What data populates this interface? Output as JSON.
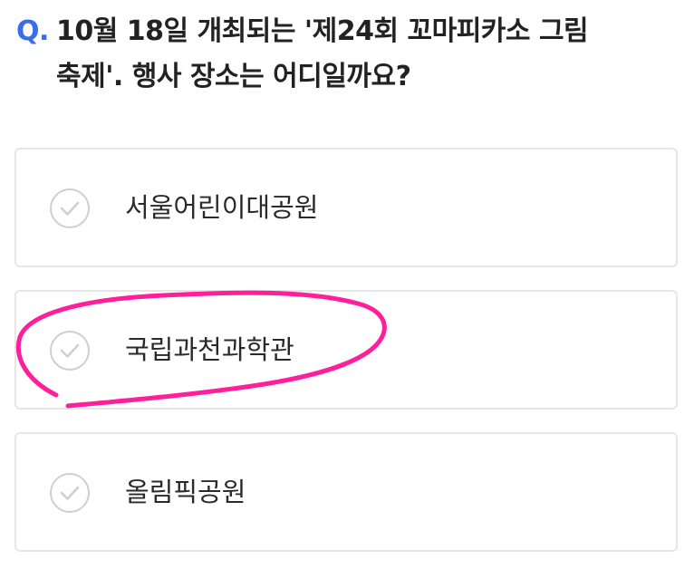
{
  "question": {
    "prefix": "Q.",
    "line1": "10월 18일 개최되는 '제24회 꼬마피카소 그림",
    "line2": "축제'. 행사 장소는 어디일까요?"
  },
  "options": [
    {
      "label": "서울어린이대공원",
      "icon": "check-circle-icon"
    },
    {
      "label": "국립과천과학관",
      "icon": "check-circle-icon",
      "annotated": true
    },
    {
      "label": "올림픽공원",
      "icon": "check-circle-icon"
    }
  ],
  "colors": {
    "accent": "#3a6ee8",
    "annotation": "#ff1f9a",
    "border": "#e6e6e6",
    "icon": "#cfcfcf"
  }
}
